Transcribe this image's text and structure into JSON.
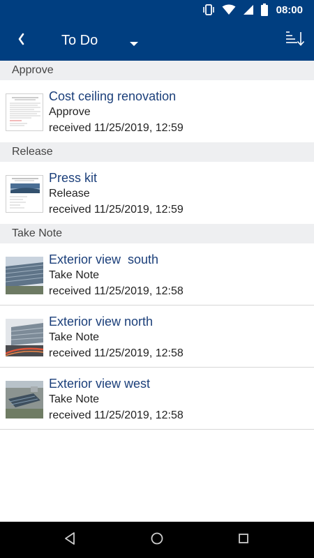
{
  "status_bar": {
    "time": "08:00",
    "icons": [
      "vibrate-icon",
      "wifi-icon",
      "signal-icon",
      "battery-icon"
    ]
  },
  "app_bar": {
    "title": "To Do",
    "back_icon": "chevron-left-icon",
    "dropdown_icon": "caret-down-icon",
    "sort_icon": "sort-icon"
  },
  "sections": [
    {
      "header": "Approve",
      "items": [
        {
          "title": "Cost ceiling renovation",
          "subtitle": "Approve",
          "date": "received 11/25/2019, 12:59",
          "thumb": "document"
        }
      ]
    },
    {
      "header": "Release",
      "items": [
        {
          "title": "Press kit",
          "subtitle": "Release",
          "date": "received 11/25/2019, 12:59",
          "thumb": "document-with-photo"
        }
      ]
    },
    {
      "header": "Take Note",
      "items": [
        {
          "title": "Exterior view  south",
          "subtitle": "Take Note",
          "date": "received 11/25/2019, 12:58",
          "thumb": "building-photo"
        },
        {
          "title": "Exterior view north",
          "subtitle": "Take Note",
          "date": "received 11/25/2019, 12:58",
          "thumb": "building-photo"
        },
        {
          "title": "Exterior view west",
          "subtitle": "Take Note",
          "date": "received 11/25/2019, 12:58",
          "thumb": "aerial-photo"
        }
      ]
    }
  ],
  "nav_bar": {
    "icons": [
      "back-triangle-icon",
      "home-circle-icon",
      "recents-square-icon"
    ]
  },
  "colors": {
    "primary": "#003e80",
    "section_bg": "#eeeff1",
    "title_text": "#1b3f7a"
  }
}
